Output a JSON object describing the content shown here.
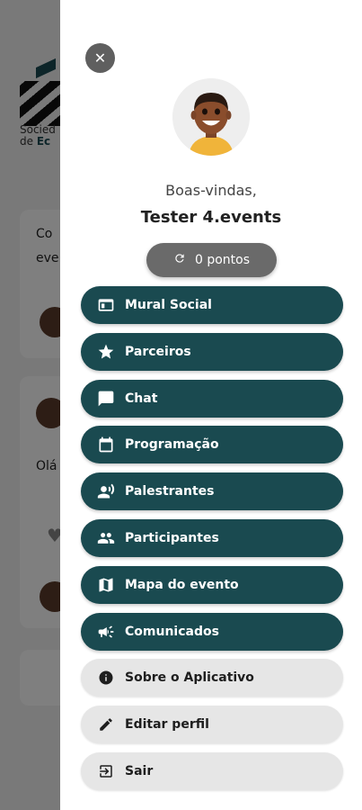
{
  "background": {
    "logo_text_line1": "Socied",
    "logo_text_line2_prefix": "de ",
    "logo_text_line2_bold": "Ec",
    "card1_text_line1": "Co",
    "card1_text_line2": "eve",
    "card2_text": "Olá"
  },
  "drawer": {
    "close_icon": "close-icon",
    "welcome": "Boas-vindas,",
    "user_name": "Tester 4.events",
    "points_label": "0 pontos",
    "menu": [
      {
        "label": "Mural Social",
        "icon": "web-icon"
      },
      {
        "label": "Parceiros",
        "icon": "star-icon"
      },
      {
        "label": "Chat",
        "icon": "chat-icon"
      },
      {
        "label": "Programação",
        "icon": "calendar-icon"
      },
      {
        "label": "Palestrantes",
        "icon": "speaker-icon"
      },
      {
        "label": "Participantes",
        "icon": "people-icon"
      },
      {
        "label": "Mapa do evento",
        "icon": "map-icon"
      },
      {
        "label": "Comunicados",
        "icon": "megaphone-icon"
      },
      {
        "label": "Sobre o Aplicativo",
        "icon": "info-icon"
      },
      {
        "label": "Editar perfil",
        "icon": "pencil-icon"
      },
      {
        "label": "Sair",
        "icon": "logout-icon"
      }
    ]
  },
  "colors": {
    "primary": "#1a4a50",
    "secondary_button": "#e6e6e6",
    "points_button": "#6a6a6a"
  }
}
